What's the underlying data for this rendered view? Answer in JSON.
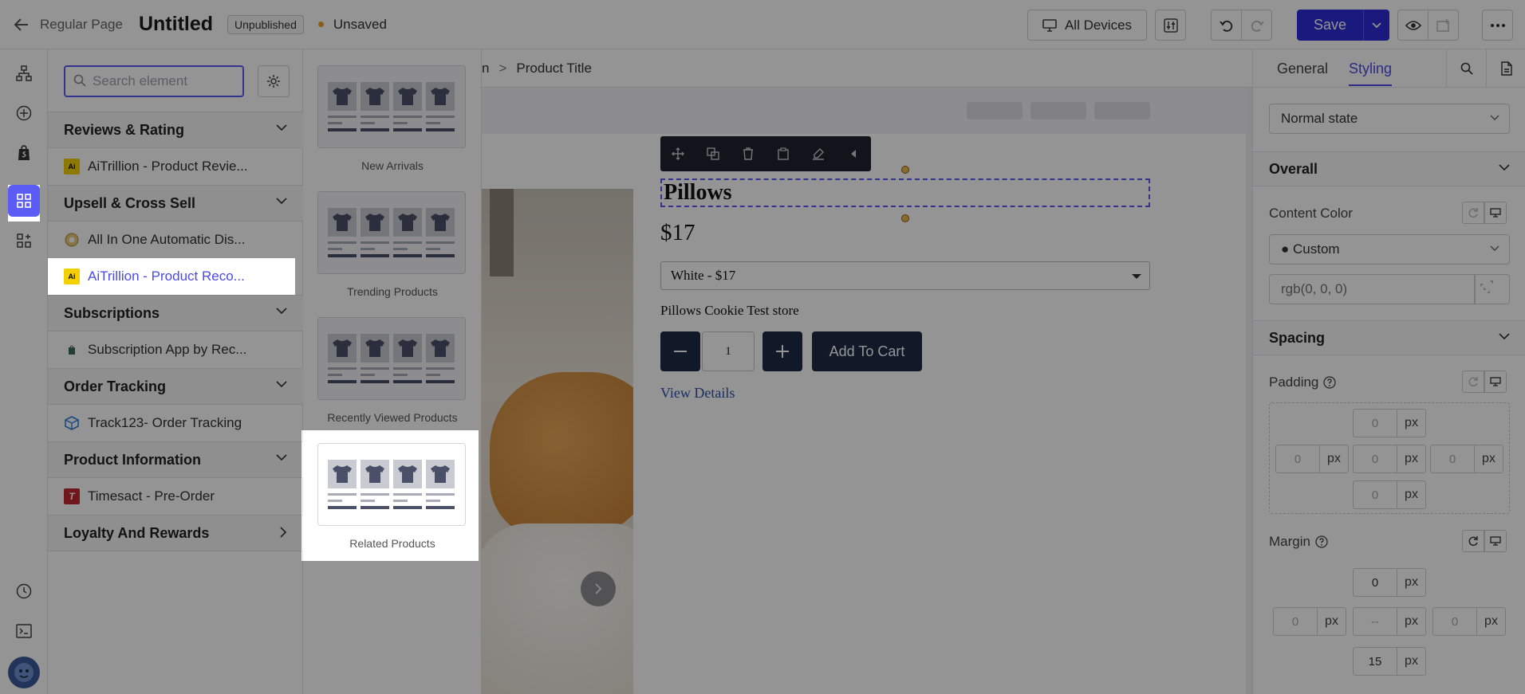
{
  "topbar": {
    "back_label": "Regular Page",
    "page_title": "Untitled",
    "status_badge": "Unpublished",
    "save_state": "Unsaved",
    "devices_label": "All Devices",
    "save_label": "Save"
  },
  "search": {
    "placeholder": "Search element"
  },
  "element_panel": {
    "categories": [
      {
        "label": "Reviews & Rating",
        "items": [
          "AiTrillion - Product Revie..."
        ]
      },
      {
        "label": "Upsell & Cross Sell",
        "items": [
          "All In One Automatic Dis...",
          "AiTrillion - Product Reco..."
        ]
      },
      {
        "label": "Subscriptions",
        "items": [
          "Subscription App by Rec..."
        ]
      },
      {
        "label": "Order Tracking",
        "items": [
          "Track123- Order Tracking"
        ]
      },
      {
        "label": "Product Information",
        "items": [
          "Timesact - Pre-Order"
        ]
      },
      {
        "label": "Loyalty And Rewards",
        "items": []
      }
    ]
  },
  "templates": [
    {
      "label": "New Arrivals"
    },
    {
      "label": "Trending Products"
    },
    {
      "label": "Recently Viewed Products"
    },
    {
      "label": "Related Products"
    }
  ],
  "canvas": {
    "breadcrumb_partial": "n",
    "breadcrumb_current": "Product Title",
    "product_title": "Pillows",
    "price": "$17",
    "variant": "White - $17",
    "store_name": "Pillows Cookie Test store",
    "quantity": "1",
    "add_to_cart": "Add To Cart",
    "view_details": "View Details"
  },
  "style_panel": {
    "tab_general": "General",
    "tab_styling": "Styling",
    "state_select": "Normal state",
    "section_overall": "Overall",
    "content_color_label": "Content Color",
    "color_mode": "● Custom",
    "color_value_placeholder": "rgb(0, 0, 0)",
    "section_spacing": "Spacing",
    "padding_label": "Padding",
    "margin_label": "Margin",
    "unit": "px",
    "padding": {
      "top": "0",
      "left": "0",
      "center": "0",
      "right": "0",
      "bottom": "0"
    },
    "margin": {
      "top": "0",
      "left": "0",
      "center": "--",
      "right": "0",
      "bottom": "15"
    }
  },
  "colors": {
    "accent": "#5b5bf5",
    "save": "#2b2bd9",
    "dark_button": "#1e2a44",
    "ai_logo": "#f5d000"
  }
}
